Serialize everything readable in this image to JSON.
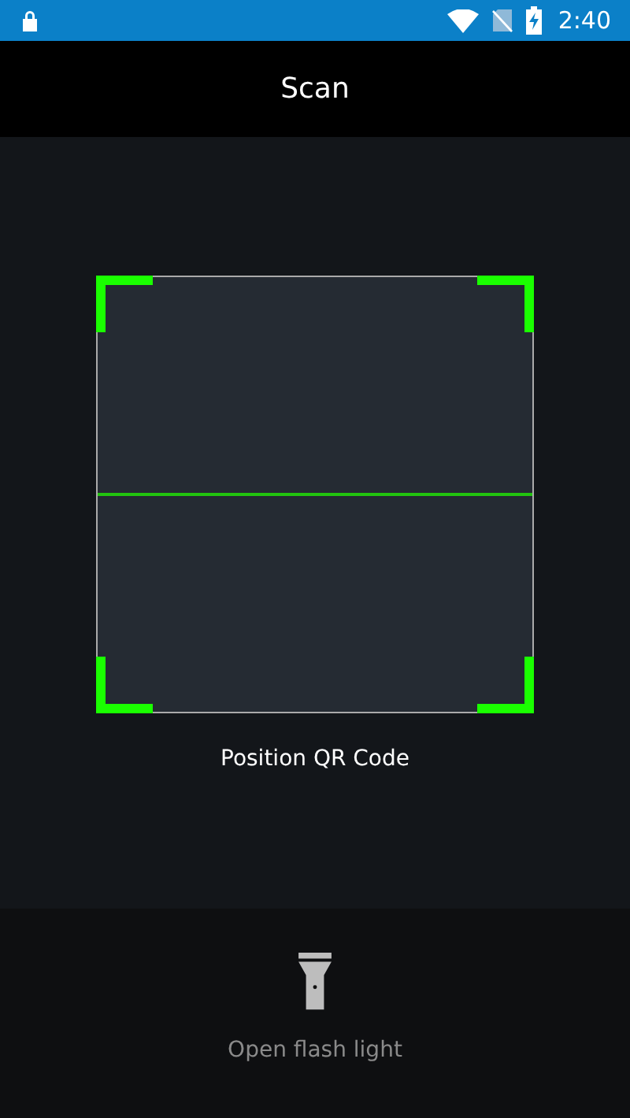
{
  "status_bar": {
    "time": "2:40"
  },
  "header": {
    "title": "Scan"
  },
  "scanner": {
    "hint": "Position QR Code"
  },
  "flash": {
    "label": "Open flash light",
    "on": false
  }
}
